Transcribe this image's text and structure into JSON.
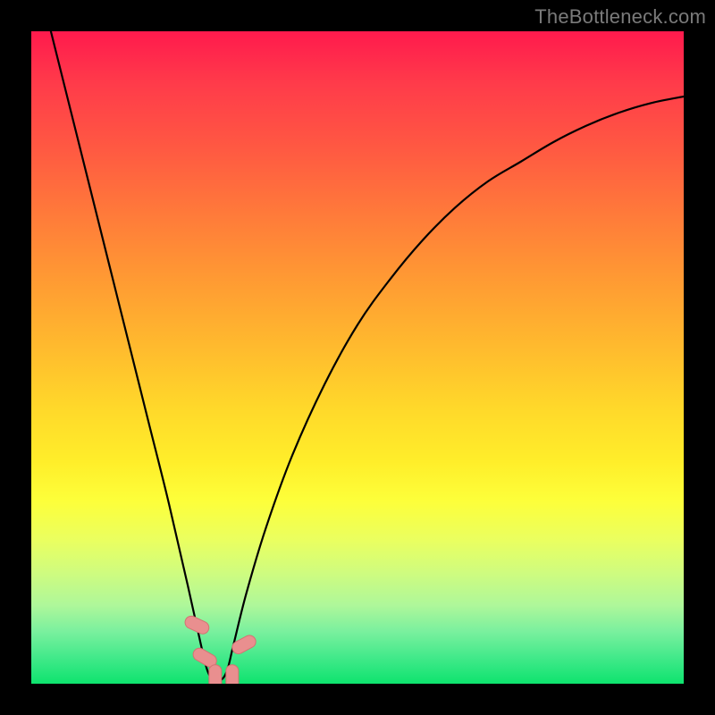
{
  "watermark": "TheBottleneck.com",
  "chart_data": {
    "type": "line",
    "title": "",
    "xlabel": "",
    "ylabel": "",
    "xlim": [
      0,
      100
    ],
    "ylim": [
      0,
      100
    ],
    "series": [
      {
        "name": "bottleneck-curve",
        "x": [
          3,
          6,
          9,
          12,
          15,
          18,
          21,
          24,
          26,
          27,
          28,
          29,
          30,
          31,
          33,
          36,
          40,
          45,
          50,
          55,
          60,
          65,
          70,
          75,
          80,
          85,
          90,
          95,
          100
        ],
        "y": [
          100,
          88,
          76,
          64,
          52,
          40,
          28,
          15,
          6,
          2,
          0.5,
          0.5,
          2,
          6,
          14,
          24,
          35,
          46,
          55,
          62,
          68,
          73,
          77,
          80,
          83,
          85.5,
          87.5,
          89,
          90
        ]
      }
    ],
    "markers": [
      {
        "name": "left-start",
        "x": 25.4,
        "y": 9.0,
        "rot": -65
      },
      {
        "name": "left-mid",
        "x": 26.6,
        "y": 4.0,
        "rot": -60
      },
      {
        "name": "valley-left",
        "x": 28.2,
        "y": 1.0,
        "rot": 0
      },
      {
        "name": "valley-right",
        "x": 30.8,
        "y": 1.0,
        "rot": 0
      },
      {
        "name": "right-end",
        "x": 32.6,
        "y": 6.0,
        "rot": 62
      }
    ],
    "colors": {
      "curve": "#000000",
      "marker_fill": "#e98f8f",
      "marker_stroke": "#d47272",
      "gradient_top": "#ff1a4d",
      "gradient_bottom": "#0ee36e"
    }
  }
}
